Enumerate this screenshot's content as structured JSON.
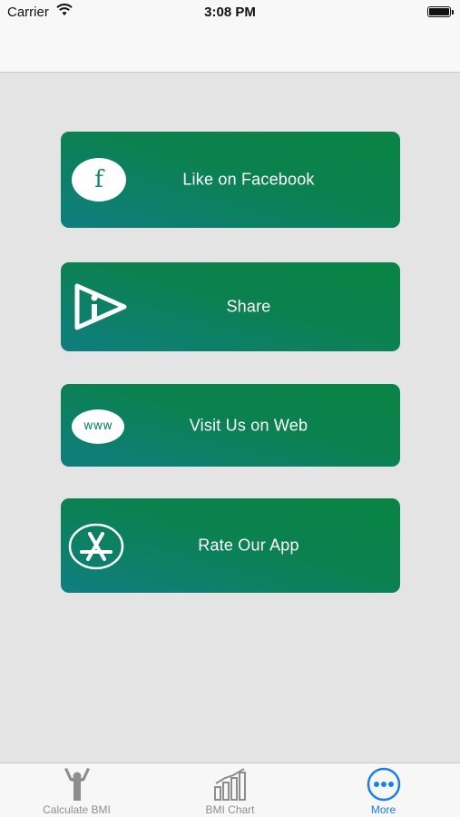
{
  "status_bar": {
    "carrier": "Carrier",
    "time": "3:08 PM"
  },
  "actions": [
    {
      "label": "Like on Facebook",
      "icon": "facebook-icon",
      "icon_text": "f"
    },
    {
      "label": "Share",
      "icon": "share-icon"
    },
    {
      "label": "Visit Us on Web",
      "icon": "www-icon",
      "icon_text": "www"
    },
    {
      "label": "Rate Our App",
      "icon": "app-store-icon"
    }
  ],
  "tabs": [
    {
      "label": "Calculate BMI",
      "icon": "person-icon",
      "active": false
    },
    {
      "label": "BMI Chart",
      "icon": "bar-chart-icon",
      "active": false
    },
    {
      "label": "More",
      "icon": "more-icon",
      "active": true
    }
  ],
  "colors": {
    "accent": "#1a7fe8",
    "button_gradient_start": "#0f7e80",
    "button_gradient_end": "#0a8443",
    "background": "#e4e4e4"
  }
}
